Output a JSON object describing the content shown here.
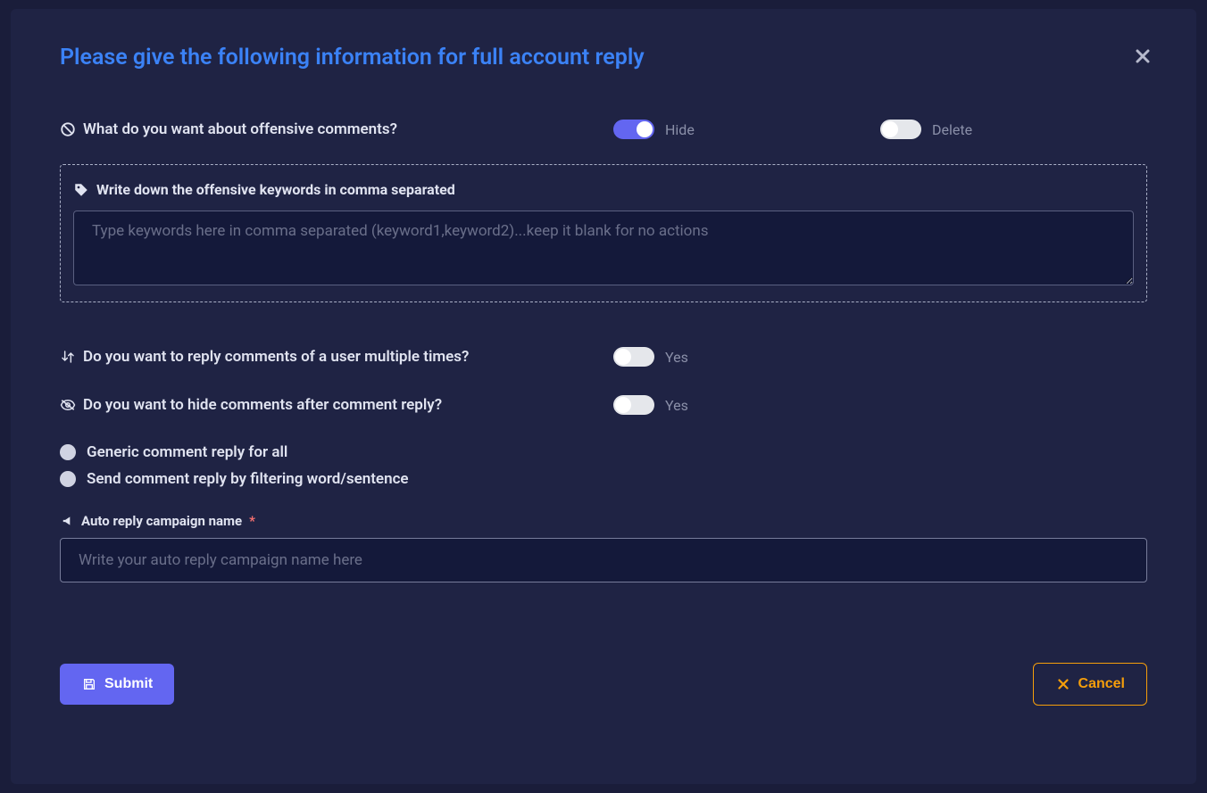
{
  "modal": {
    "title": "Please give the following information for full account reply",
    "offensive_question": "What do you want about offensive comments?",
    "hide_label": "Hide",
    "delete_label": "Delete",
    "keywords_label": "Write down the offensive keywords in comma separated",
    "keywords_placeholder": "Type keywords here in comma separated (keyword1,keyword2)...keep it blank for no actions",
    "reply_multiple_question": "Do you want to reply comments of a user multiple times?",
    "yes_label": "Yes",
    "hide_after_reply_question": "Do you want to hide comments after comment reply?",
    "radio_generic": "Generic comment reply for all",
    "radio_filter": "Send comment reply by filtering word/sentence",
    "campaign_label": "Auto reply campaign name",
    "campaign_placeholder": "Write your auto reply campaign name here",
    "submit_label": "Submit",
    "cancel_label": "Cancel"
  }
}
